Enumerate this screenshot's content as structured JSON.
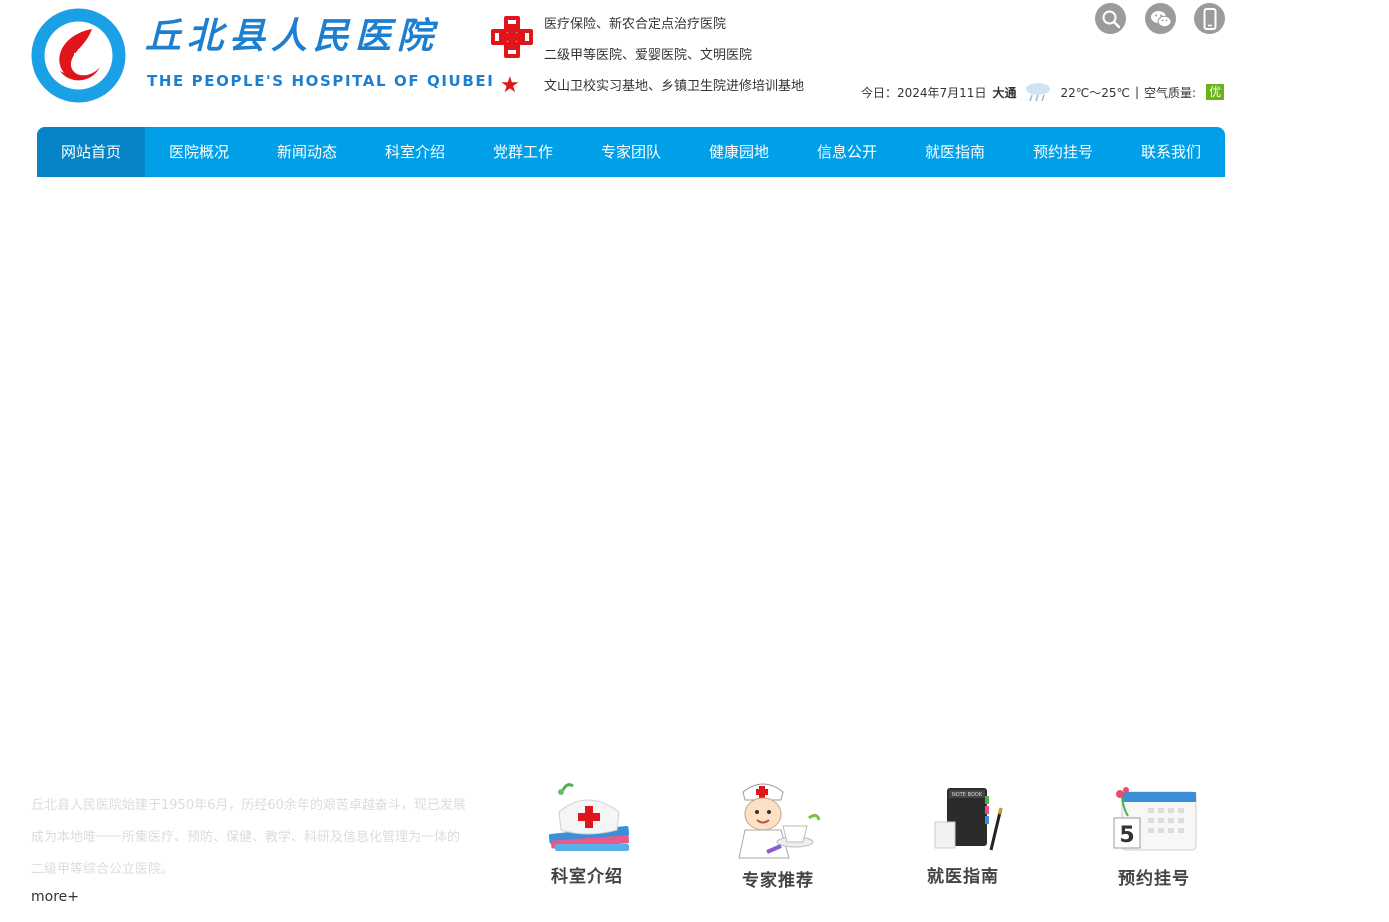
{
  "header": {
    "logo_cn": "丘北县人民医院",
    "logo_en": "THE PEOPLE'S HOSPITAL OF QIUBEI",
    "logo_ring_text": "丘北县人民医院 THE PEOPLE'S HOSPITAL OF QIUBEI",
    "tags": [
      "医疗保险、新农合定点治疗医院",
      "二级甲等医院、爱婴医院、文明医院",
      "文山卫校实习基地、乡镇卫生院进修培训基地"
    ],
    "icons": [
      "search-icon",
      "wechat-icon",
      "mobile-icon"
    ],
    "weather": {
      "date_label": "今日：2024年7月11日",
      "city": "大通",
      "weather_icon": "rain-cloud-icon",
      "temp": "22℃～25℃",
      "sep": "|",
      "air_label": "空气质量:",
      "air_value": "优"
    }
  },
  "nav": {
    "items": [
      "网站首页",
      "医院概况",
      "新闻动态",
      "科室介绍",
      "党群工作",
      "专家团队",
      "健康园地",
      "信息公开",
      "就医指南",
      "预约挂号",
      "联系我们"
    ],
    "active_index": 0
  },
  "intro": {
    "text": "丘北县人民医院始建于1950年6月，历经60余年的艰苦卓越奋斗，现已发展成为本地唯一一所集医疗、预防、保健、教学、科研及信息化管理为一体的二级甲等综合公立医院。",
    "more": "more+"
  },
  "quick_links": [
    "科室介绍",
    "专家推荐",
    "就医指南",
    "预约挂号"
  ],
  "colors": {
    "brand_blue": "#1d7fd0",
    "nav_bg": "#00a0e9",
    "nav_active": "#0784c7",
    "red": "#e0151b",
    "air_green": "#6ab515"
  }
}
